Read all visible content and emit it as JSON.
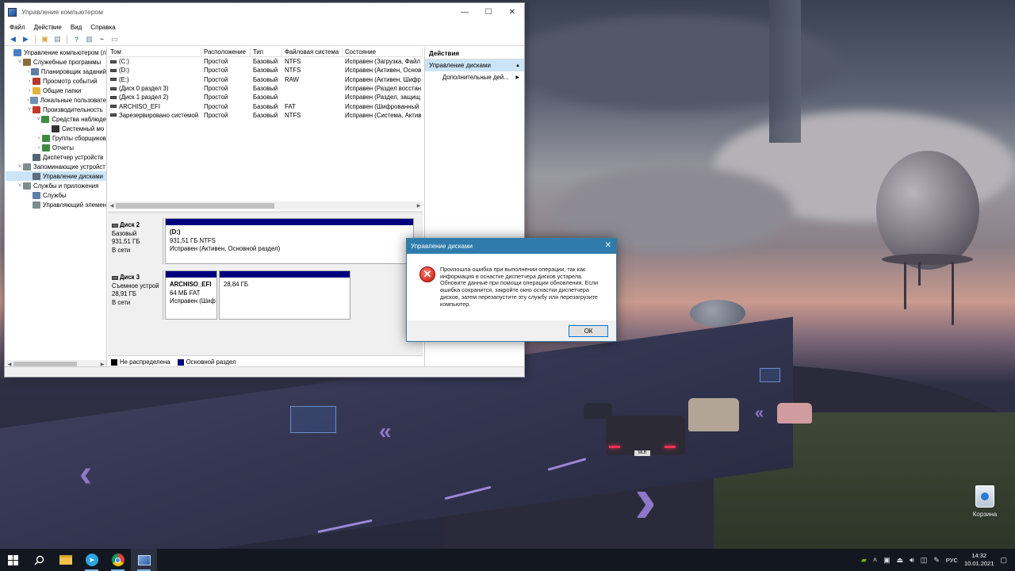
{
  "desktop": {
    "recycle_bin_label": "Корзина",
    "plate_text": "MLB"
  },
  "window": {
    "title": "Управление компьютером",
    "controls": {
      "minimize": "—",
      "maximize": "☐",
      "close": "✕"
    },
    "menu": [
      "Файл",
      "Действие",
      "Вид",
      "Справка"
    ]
  },
  "tree": {
    "items": [
      {
        "label": "Управление компьютером (л",
        "indent": 0,
        "exp": "",
        "icon": "computer-icon",
        "color": "#4a7fc8"
      },
      {
        "label": "Служебные программы",
        "indent": 1,
        "exp": "˅",
        "icon": "tools-icon",
        "color": "#8a6d3b"
      },
      {
        "label": "Планировщик заданий",
        "indent": 2,
        "exp": "›",
        "icon": "clock-icon",
        "color": "#5d7fa6"
      },
      {
        "label": "Просмотр событий",
        "indent": 2,
        "exp": "›",
        "icon": "event-icon",
        "color": "#b03a2e"
      },
      {
        "label": "Общие папки",
        "indent": 2,
        "exp": "›",
        "icon": "folder-icon",
        "color": "#e2b33c"
      },
      {
        "label": "Локальные пользовате",
        "indent": 2,
        "exp": "›",
        "icon": "users-icon",
        "color": "#6f8fb5"
      },
      {
        "label": "Производительность",
        "indent": 2,
        "exp": "˅",
        "icon": "performance-icon",
        "color": "#c0392b"
      },
      {
        "label": "Средства наблюде",
        "indent": 3,
        "exp": "˅",
        "icon": "monitor-tools-icon",
        "color": "#3d8b40"
      },
      {
        "label": "Системный мо",
        "indent": 4,
        "exp": "",
        "icon": "chart-icon",
        "color": "#333333"
      },
      {
        "label": "Группы сборщиков",
        "indent": 3,
        "exp": "›",
        "icon": "collector-icon",
        "color": "#3d8b40"
      },
      {
        "label": "Отчеты",
        "indent": 3,
        "exp": "›",
        "icon": "report-icon",
        "color": "#3d8b40"
      },
      {
        "label": "Диспетчер устройств",
        "indent": 2,
        "exp": "",
        "icon": "device-icon",
        "color": "#566573"
      },
      {
        "label": "Запоминающие устройст",
        "indent": 1,
        "exp": "˅",
        "icon": "storage-icon",
        "color": "#7f8c8d"
      },
      {
        "label": "Управление дисками",
        "indent": 2,
        "exp": "",
        "icon": "disk-management-icon",
        "color": "#5d6d7e",
        "selected": true
      },
      {
        "label": "Службы и приложения",
        "indent": 1,
        "exp": "˅",
        "icon": "services-apps-icon",
        "color": "#7f8c8d"
      },
      {
        "label": "Службы",
        "indent": 2,
        "exp": "",
        "icon": "services-icon",
        "color": "#5d7fa6"
      },
      {
        "label": "Управляющий элемен",
        "indent": 2,
        "exp": "",
        "icon": "wmi-icon",
        "color": "#7f8c8d"
      }
    ]
  },
  "volumes": {
    "headers": [
      "Том",
      "Расположение",
      "Тип",
      "Файловая система",
      "Состояние"
    ],
    "rows": [
      [
        "(C:)",
        "Простой",
        "Базовый",
        "NTFS",
        "Исправен (Загрузка, Файл"
      ],
      [
        "(D:)",
        "Простой",
        "Базовый",
        "NTFS",
        "Исправен (Активен, Основ"
      ],
      [
        "(E:)",
        "Простой",
        "Базовый",
        "RAW",
        "Исправен (Активен, Шифр"
      ],
      [
        "(Диск 0 раздел 3)",
        "Простой",
        "Базовый",
        "",
        "Исправен (Раздел восстан"
      ],
      [
        "(Диск 1 раздел 2)",
        "Простой",
        "Базовый",
        "",
        "Исправен (Раздел, защищ"
      ],
      [
        "ARCHISO_EFI",
        "Простой",
        "Базовый",
        "FAT",
        "Исправен (Шифрованный"
      ],
      [
        "Зарезервировано системой",
        "Простой",
        "Базовый",
        "NTFS",
        "Исправен (Система, Актив"
      ]
    ]
  },
  "disks": [
    {
      "name": "Диск 2",
      "type": "Базовый",
      "size": "931,51 ГБ",
      "status": "В сети",
      "partitions": [
        {
          "title": "(D:)",
          "line1": "931,51 ГБ NTFS",
          "line2": "Исправен (Активен, Основной раздел)"
        }
      ]
    },
    {
      "name": "Диск 3",
      "type": "Съемное устрой",
      "size": "28,91 ГБ",
      "status": "В сети",
      "partitions": [
        {
          "title": "ARCHISO_EFI",
          "line1": "64 МБ FAT",
          "line2": "Исправен (Шиф"
        },
        {
          "title": "",
          "line1": "28,84 ГБ",
          "line2": ""
        }
      ]
    }
  ],
  "legend": [
    {
      "label": "Не распределена",
      "color": "#000000"
    },
    {
      "label": "Основной раздел",
      "color": "#00007f"
    }
  ],
  "actions": {
    "title": "Действия",
    "section": "Управление дисками",
    "more": "Дополнительные дей..."
  },
  "dialog": {
    "title": "Управление дисками",
    "close": "✕",
    "message": "Произошла ошибка при выполнении операции, так как информация в оснастке диспетчера дисков устарела. Обновите данные при помощи операции обновления. Если ошибка сохранится, закройте окно оснастки диспетчера дисков, затем перезапустите эту службу или перезагрузите компьютер.",
    "ok": "ОК"
  },
  "taskbar": {
    "lang": "РУС",
    "time": "14:32",
    "date": "10.01.2021"
  },
  "colors": {
    "accent": "#2f7cac",
    "primary_partition": "#00007f",
    "selection": "#cce4f7"
  }
}
